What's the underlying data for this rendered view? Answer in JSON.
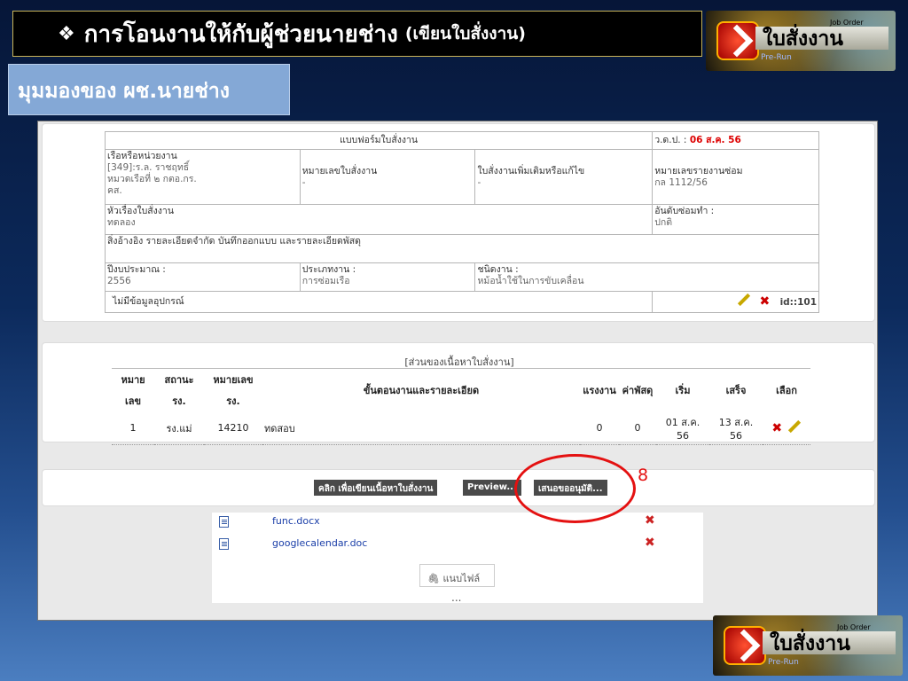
{
  "slide": {
    "bullet": "❖",
    "title": "การโอนงานให้กับผู้ช่วยนายช่าง",
    "title_note": "(เขียนใบสั่งงาน)",
    "view_label": "มุมมองของ ผช.นายช่าง",
    "callout_number": "8"
  },
  "logo": {
    "text": "ใบสั่งงาน",
    "job_order": "Job Order",
    "pre_run": "Pre-Run"
  },
  "form": {
    "header": "แบบฟอร์มใบสั่งงาน",
    "date_label": "ว.ด.ป. :",
    "date_value": "06 ส.ค. 56",
    "ship_label": "เรือหรือหน่วยงาน",
    "ship_value": "[349]:ร.ล. ราชฤทธิ์",
    "ship_unit": "หมวดเรือที่ ๒ กตอ.กร.",
    "ship_unit2": "คส.",
    "order_no_label": "หมายเลขใบสั่งงาน",
    "order_no_value": "-",
    "extra_order_label": "ใบสั่งงานเพิ่มเติมหรือแก้ไข",
    "extra_order_value": "-",
    "report_no_label": "หมายเลขรายงานซ่อม",
    "report_no_value": "กล 1112/56",
    "subject_label": "หัวเรื่องใบสั่งงาน",
    "subject_value": "ทดลอง",
    "priority_label": "อันดับซ่อมทำ :",
    "priority_value": "ปกติ",
    "references": "สิ่งอ้างอิง รายละเอียดจำกัด บันทึกออกแบบ และรายละเอียดพัสดุ",
    "budget_label": "ปีงบประมาณ :",
    "budget_value": "2556",
    "work_type_label": "ประเภทงาน :",
    "work_type_value": "การซ่อมเรือ",
    "job_kind_label": "ชนิดงาน :",
    "job_kind_value": "หม้อน้ำใช้ในการขับเคลื่อน",
    "no_equipment": "ไม่มีข้อมูลอุปกรณ์",
    "id_text": "id::101"
  },
  "content": {
    "section_title": "[ส่วนของเนื้อหาใบสั่งงาน]",
    "columns": {
      "no_top": "หมาย",
      "no_bottom": "เลข",
      "status_top": "สถานะ",
      "status_bottom": "รง.",
      "number_top": "หมายเลข",
      "number_bottom": "รง.",
      "steps": "ขั้นตอนงานและรายละเอียด",
      "labor": "แรงงาน",
      "material": "ค่าพัสดุ",
      "start": "เริ่ม",
      "finish": "เสร็จ",
      "select": "เลือก"
    },
    "rows": [
      {
        "no": "1",
        "status": "รง.แม่",
        "number": "14210",
        "detail": "ทดสอบ",
        "labor": "0",
        "material": "0",
        "start": "01 ส.ค. 56",
        "finish": "13 ส.ค. 56"
      }
    ]
  },
  "actions": {
    "write_content": "คลิก เพื่อเขียนเนื้อหาใบสั่งงาน",
    "preview": "Preview...",
    "submit": "เสนอขออนุมัติ..."
  },
  "files": {
    "items": [
      {
        "name": "func.docx"
      },
      {
        "name": "googlecalendar.doc"
      }
    ],
    "attach_label": "แนบไฟล์",
    "more": "..."
  }
}
